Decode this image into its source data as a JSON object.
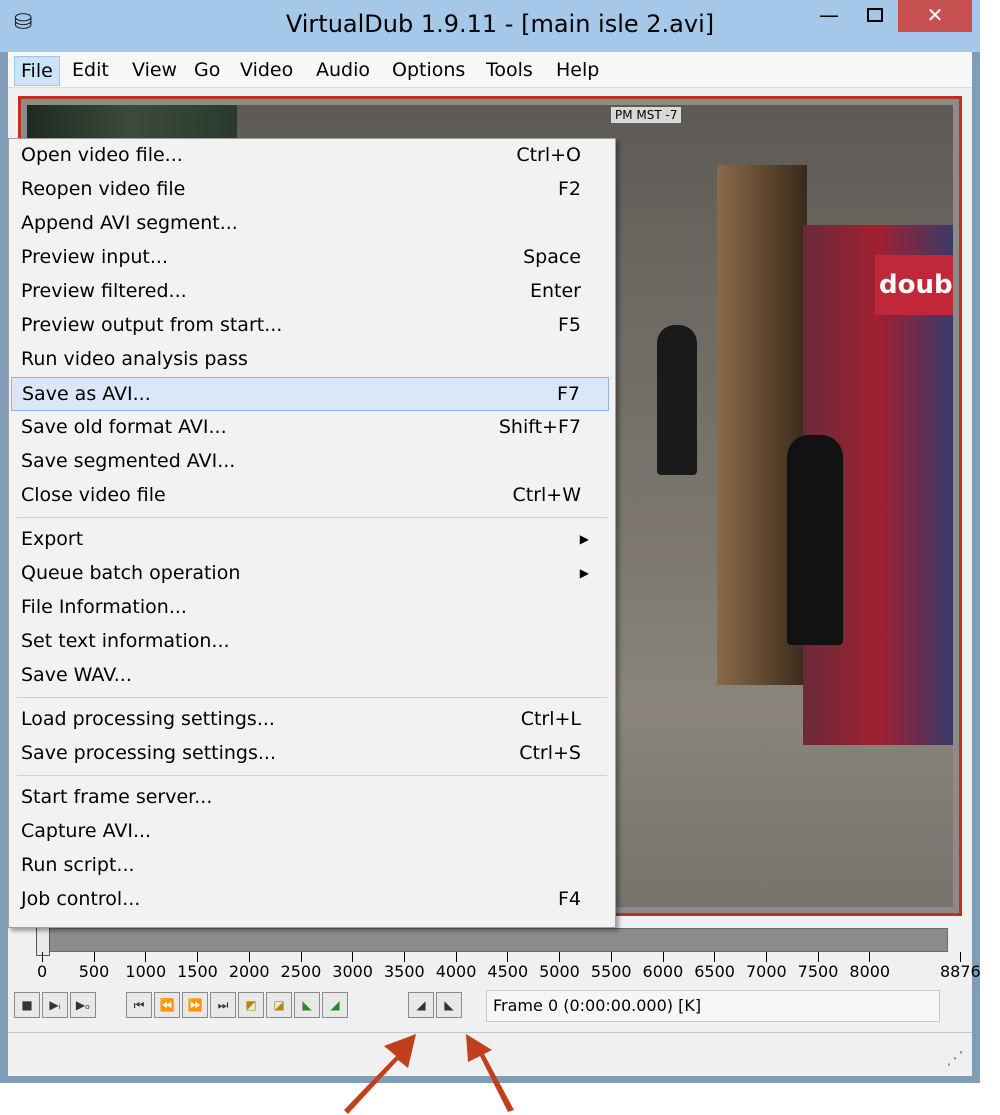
{
  "window": {
    "title": "VirtualDub 1.9.11 - [main isle 2.avi]",
    "minimize_glyph": "—",
    "close_glyph": "✕",
    "app_icon": "virtualdub-app-icon"
  },
  "menubar": [
    "File",
    "Edit",
    "View",
    "Go",
    "Video",
    "Audio",
    "Options",
    "Tools",
    "Help"
  ],
  "file_menu": [
    {
      "label": "Open video file...",
      "shortcut": "Ctrl+O"
    },
    {
      "label": "Reopen video file",
      "shortcut": "F2"
    },
    {
      "label": "Append AVI segment...",
      "shortcut": ""
    },
    {
      "label": "Preview input...",
      "shortcut": "Space"
    },
    {
      "label": "Preview filtered...",
      "shortcut": "Enter"
    },
    {
      "label": "Preview output from start...",
      "shortcut": "F5"
    },
    {
      "label": "Run video analysis pass",
      "shortcut": ""
    },
    {
      "label": "Save as AVI...",
      "shortcut": "F7",
      "highlighted": true
    },
    {
      "label": "Save old format AVI...",
      "shortcut": "Shift+F7"
    },
    {
      "label": "Save segmented AVI...",
      "shortcut": ""
    },
    {
      "label": "Close video file",
      "shortcut": "Ctrl+W"
    },
    {
      "label": "Export",
      "submenu": true
    },
    {
      "label": "Queue batch operation",
      "submenu": true
    },
    {
      "label": "File Information...",
      "shortcut": ""
    },
    {
      "label": "Set text information...",
      "shortcut": ""
    },
    {
      "label": "Save WAV...",
      "shortcut": ""
    },
    {
      "label": "Load processing settings...",
      "shortcut": "Ctrl+L"
    },
    {
      "label": "Save processing settings...",
      "shortcut": "Ctrl+S"
    },
    {
      "label": "Start frame server...",
      "shortcut": ""
    },
    {
      "label": "Capture AVI...",
      "shortcut": ""
    },
    {
      "label": "Run script...",
      "shortcut": ""
    },
    {
      "label": "Job control...",
      "shortcut": "F4"
    }
  ],
  "video": {
    "timestamp_fragment": "PM MST -7",
    "sign_fragment": "doub"
  },
  "timeline": {
    "labels": [
      "0",
      "500",
      "1000",
      "1500",
      "2000",
      "2500",
      "3000",
      "3500",
      "4000",
      "4500",
      "5000",
      "5500",
      "6000",
      "6500",
      "7000",
      "7500",
      "8000",
      "8876"
    ],
    "position_frame": 0,
    "total_frames": 8876
  },
  "status": {
    "frame_text": "Frame 0 (0:00:00.000) [K]"
  },
  "colors": {
    "annotation_arrow": "#c0401c",
    "menu_highlight": "#dbe7f6",
    "video_border": "#c03020"
  }
}
